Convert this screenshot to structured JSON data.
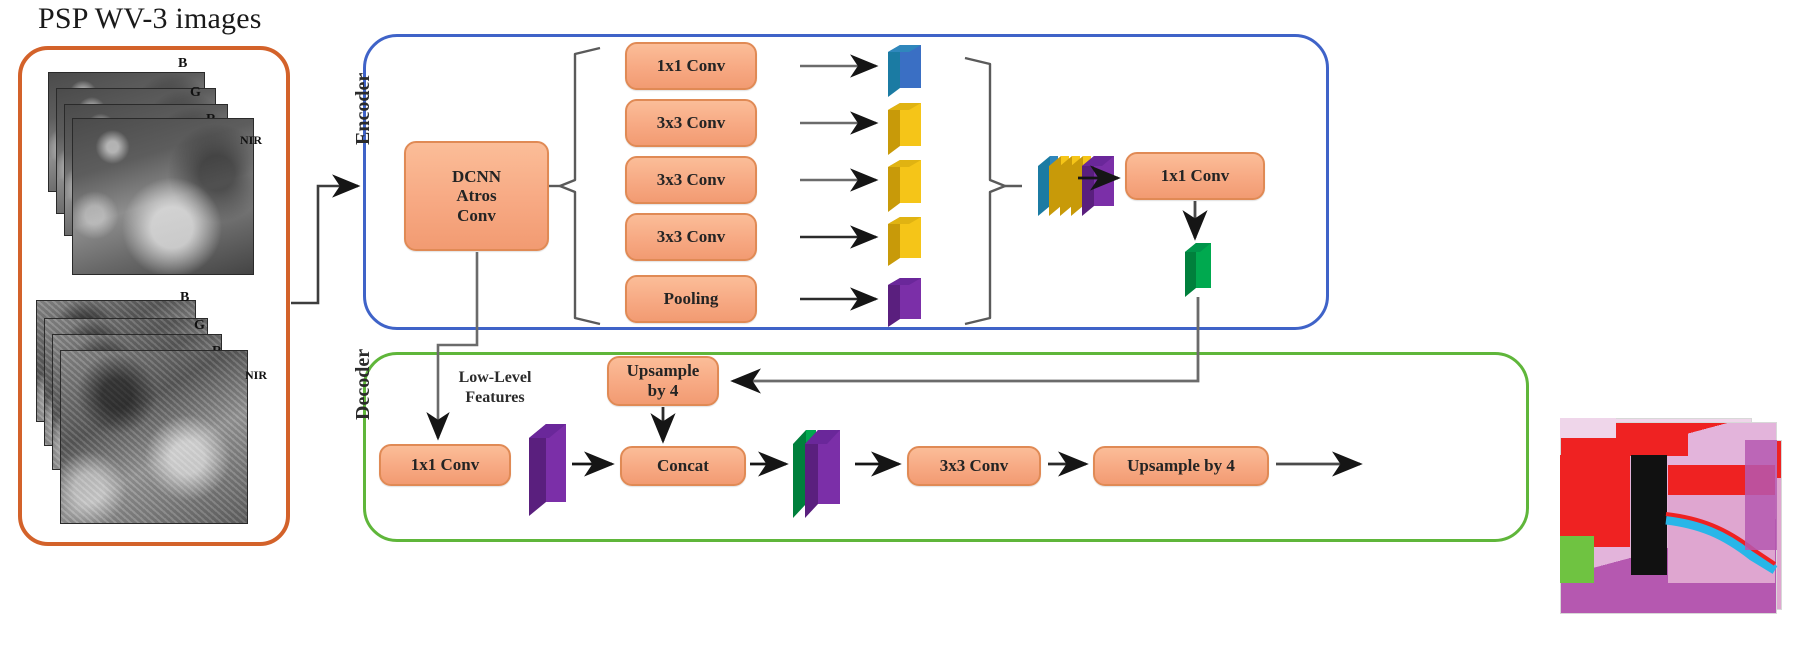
{
  "figure": {
    "title": "PSP WV-3 images"
  },
  "input_panel": {
    "border_color": "#d3622a",
    "band_labels": [
      "B",
      "G",
      "R",
      "NIR"
    ],
    "stack_top_bands": [
      "B",
      "G",
      "R",
      "NIR"
    ],
    "stack_bottom_bands": [
      "B",
      "G",
      "R",
      "NIR"
    ]
  },
  "encoder": {
    "label": "Encoder",
    "border_color": "#3f63c8",
    "backbone": {
      "label": "DCNN\nAtros\nConv",
      "line1": "DCNN",
      "line2": "Atros",
      "line3": "Conv"
    },
    "aspp_branches": [
      {
        "label": "1x1 Conv",
        "slab_color": "#3a6fc4",
        "slab_edge": "#1b7ba3"
      },
      {
        "label": "3x3 Conv",
        "slab_color": "#f5c518",
        "slab_edge": "#c89a09"
      },
      {
        "label": "3x3 Conv",
        "slab_color": "#f5c518",
        "slab_edge": "#c89a09"
      },
      {
        "label": "3x3 Conv",
        "slab_color": "#f5c518",
        "slab_edge": "#c89a09"
      },
      {
        "label": "Pooling",
        "slab_color": "#7b2fa8",
        "slab_edge": "#5a1f7e"
      }
    ],
    "concat_stack_colors": [
      "#1b7ba3",
      "#3a6fc4",
      "#d4a200",
      "#f5c518",
      "#d4a200",
      "#f5c518",
      "#7b2fa8"
    ],
    "projection": {
      "label": "1x1 Conv"
    },
    "output_slab_color": "#00a94f"
  },
  "decoder": {
    "label": "Decoder",
    "border_color": "#5fb63a",
    "low_level_note": "Low-Level\nFeatures",
    "low_level_line1": "Low-Level",
    "low_level_line2": "Features",
    "boxes": {
      "low_level_conv": "1x1 Conv",
      "upsample_first": "Upsample\nby 4",
      "upsample_first_line1": "Upsample",
      "upsample_first_line2": "by 4",
      "concat": "Concat",
      "refine_conv": "3x3 Conv",
      "upsample_final": "Upsample by 4"
    },
    "low_level_slab_color": "#7b2fa8",
    "concat_slab_colors": [
      "#00a94f",
      "#7b2fa8"
    ]
  },
  "output_panel": {
    "map_count": 3,
    "legend_colors": [
      "#ef2222",
      "#dfa6d0",
      "#6fc341",
      "#29b6e8",
      "#111111",
      "#b558b0"
    ]
  },
  "palette": {
    "box_fill": "#f7a983",
    "box_border": "#e08a55",
    "arrow": "#2b2b2b",
    "bracket": "#555555",
    "encoder_border": "#3f63c8",
    "decoder_border": "#5fb63a",
    "input_border": "#d3622a"
  }
}
